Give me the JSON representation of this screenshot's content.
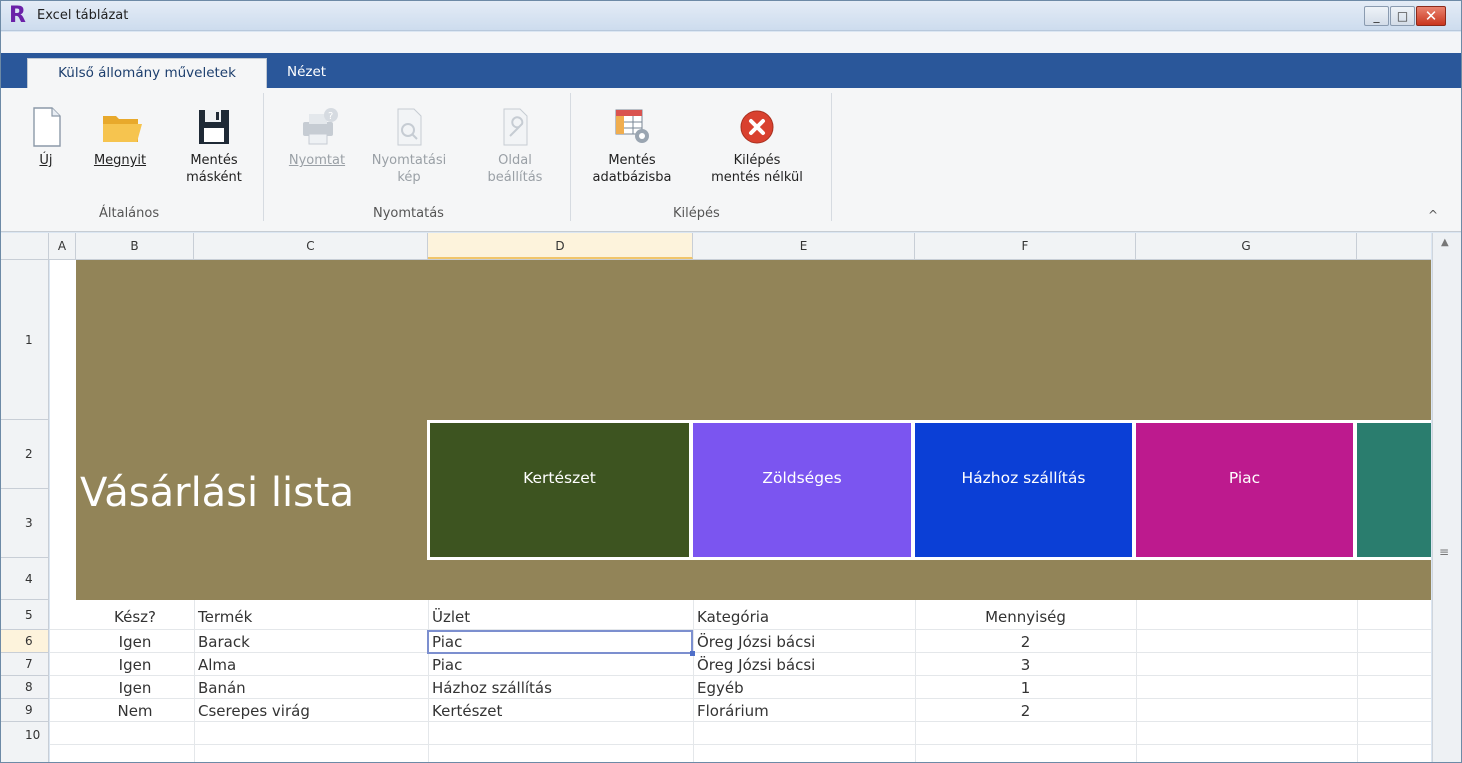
{
  "window": {
    "title": "Excel táblázat",
    "logo_letter": "R",
    "min_glyph": "_",
    "max_glyph": "□",
    "close_glyph": "✕"
  },
  "ribbon_tabs": [
    "Külső állomány műveletek",
    "Nézet"
  ],
  "ribbon": {
    "groups": {
      "general": "Általános",
      "print": "Nyomtatás",
      "exit": "Kilépés"
    },
    "buttons": {
      "new": "Új",
      "open": "Megnyit",
      "save_as_1": "Mentés",
      "save_as_2": "másként",
      "print": "Nyomtat",
      "preview_1": "Nyomtatási",
      "preview_2": "kép",
      "page_setup_1": "Oldal",
      "page_setup_2": "beállítás",
      "save_db_1": "Mentés",
      "save_db_2": "adatbázisba",
      "exit_1": "Kilépés",
      "exit_2": "mentés nélkül"
    },
    "collapse_glyph": "^"
  },
  "columns": [
    "A",
    "B",
    "C",
    "D",
    "E",
    "F",
    "G"
  ],
  "rows": [
    "1",
    "2",
    "3",
    "4",
    "5",
    "6",
    "7",
    "8",
    "9",
    "10"
  ],
  "sheet": {
    "title": "Vásárlási lista",
    "tiles": [
      {
        "label": "Kertészet",
        "color": "#3d5420"
      },
      {
        "label": "Zöldséges",
        "color": "#7b55f0"
      },
      {
        "label": "Házhoz szállítás",
        "color": "#0b3fd6"
      },
      {
        "label": "Piac",
        "color": "#bd1a8e"
      },
      {
        "label": "",
        "color": "#2a7d6e"
      }
    ],
    "table_headers": [
      "Kész?",
      "Termék",
      "Üzlet",
      "Kategória",
      "Mennyiség"
    ],
    "table_rows": [
      [
        "Igen",
        "Barack",
        "Piac",
        "Öreg Józsi bácsi",
        "2"
      ],
      [
        "Igen",
        "Alma",
        "Piac",
        "Öreg Józsi bácsi",
        "3"
      ],
      [
        "Igen",
        "Banán",
        "Házhoz szállítás",
        "Egyéb",
        "1"
      ],
      [
        "Nem",
        "Cserepes virág",
        "Kertészet",
        "Florárium",
        "2"
      ]
    ],
    "banner_color": "#928458"
  },
  "scrollbar": {
    "grip": "≡",
    "up": "▲"
  }
}
